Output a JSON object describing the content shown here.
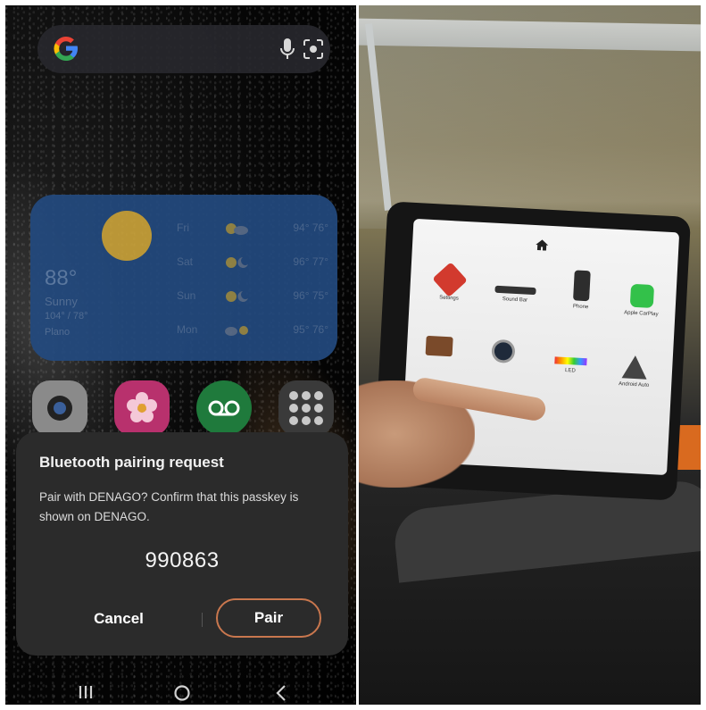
{
  "search": {
    "logo": "G"
  },
  "weather": {
    "current_temp": "88°",
    "condition": "Sunny",
    "hi_lo": "104° / 78°",
    "location": "Plano",
    "forecast": [
      {
        "day": "Fri",
        "temp": "94° 76°"
      },
      {
        "day": "Sat",
        "temp": "96° 77°"
      },
      {
        "day": "Sun",
        "temp": "96° 75°"
      },
      {
        "day": "Mon",
        "temp": "95° 76°"
      }
    ]
  },
  "dialog": {
    "title": "Bluetooth pairing request",
    "body": "Pair with DENAGO? Confirm that this passkey is shown on DENAGO.",
    "passkey": "990863",
    "cancel_label": "Cancel",
    "pair_label": "Pair"
  },
  "car_screen": {
    "apps": [
      "Settings",
      "Sound Bar",
      "Phone",
      "Apple CarPlay",
      "LED",
      "Android Auto"
    ]
  },
  "colors": {
    "pair_outline": "#c9774e",
    "dialog_bg": "#2b2b2b",
    "weather_bg": "#234a7f"
  }
}
